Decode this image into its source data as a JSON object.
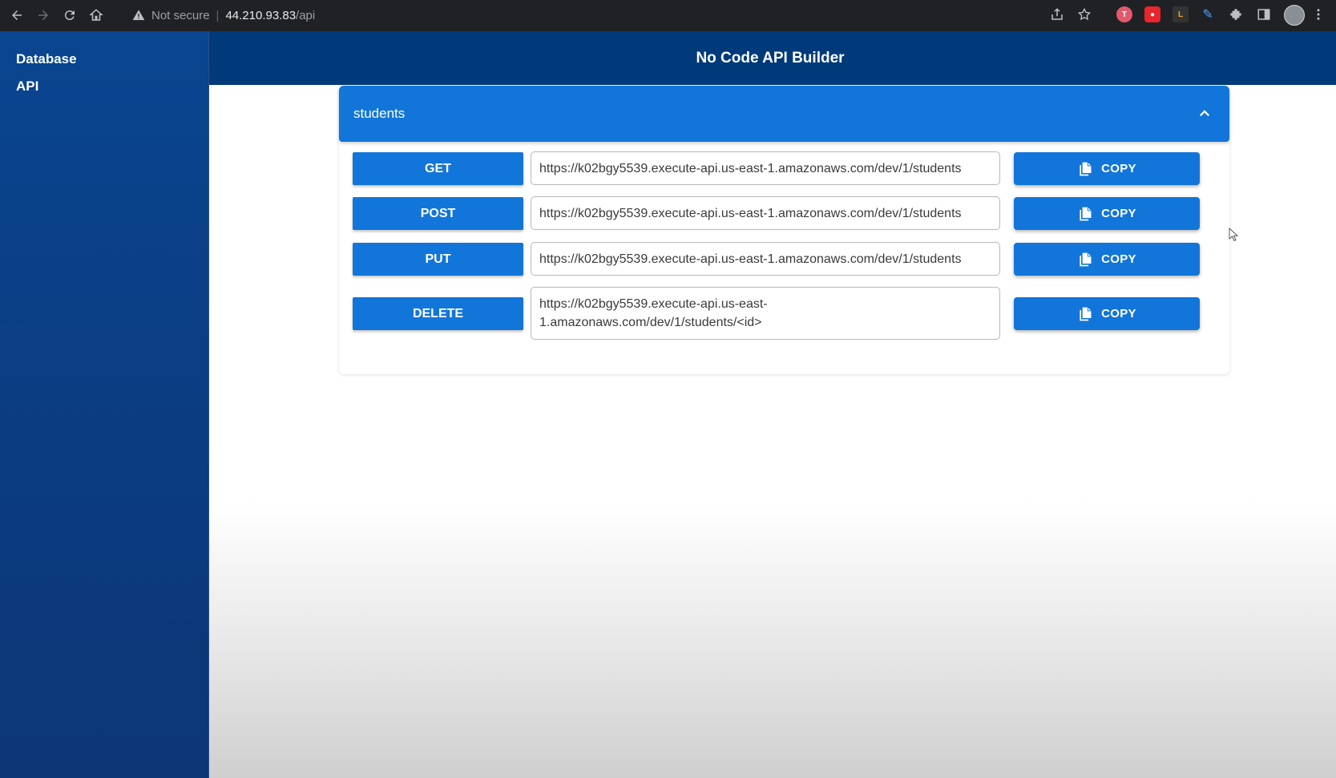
{
  "browser": {
    "security_label": "Not secure",
    "url_host": "44.210.93.83",
    "url_path": "/api"
  },
  "sidebar": {
    "items": [
      {
        "label": "Database"
      },
      {
        "label": "API"
      }
    ]
  },
  "header": {
    "title": "No Code API Builder"
  },
  "table": {
    "name": "students",
    "expanded": true,
    "endpoints": [
      {
        "method": "GET",
        "url": "https://k02bgy5539.execute-api.us-east-1.amazonaws.com/dev/1/students",
        "copy_label": "COPY"
      },
      {
        "method": "POST",
        "url": "https://k02bgy5539.execute-api.us-east-1.amazonaws.com/dev/1/students",
        "copy_label": "COPY"
      },
      {
        "method": "PUT",
        "url": "https://k02bgy5539.execute-api.us-east-1.amazonaws.com/dev/1/students",
        "copy_label": "COPY"
      },
      {
        "method": "DELETE",
        "url": "https://k02bgy5539.execute-api.us-east-1.amazonaws.com/dev/1/students/<id>",
        "copy_label": "COPY"
      }
    ]
  },
  "colors": {
    "primary": "#1275d9",
    "header_bg": "#003a7a",
    "sidebar_bg": "#0a4690"
  },
  "icons": [
    "back-icon",
    "forward-icon",
    "reload-icon",
    "home-icon",
    "warning-icon",
    "share-icon",
    "star-icon",
    "extensions-icon",
    "menu-icon",
    "chevron-up-icon",
    "copy-icon"
  ]
}
